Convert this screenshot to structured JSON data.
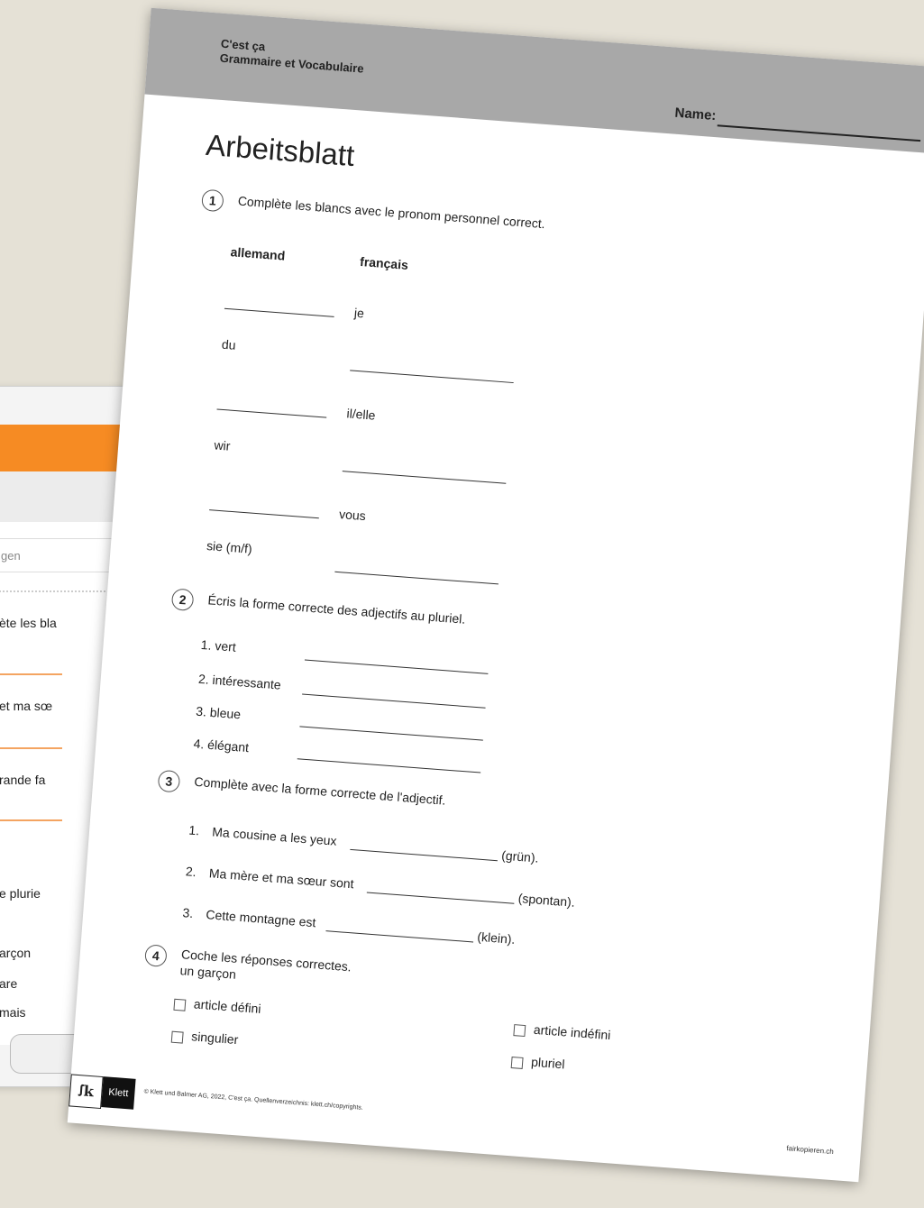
{
  "background_app": {
    "search_text": "gen",
    "row1": "ète les bla",
    "row2": "et ma sœ",
    "row3": "rande fa",
    "row4": "e plurie",
    "row5": "arçon",
    "row6": "are",
    "row7": "mais",
    "accent_color": "#f68b23"
  },
  "sheet": {
    "brand_line1": "C'est ça",
    "brand_line2": "Grammaire et Vocabulaire",
    "name_label": "Name:",
    "title": "Arbeitsblatt",
    "ex1": {
      "number": "1",
      "instruction": "Complète les blancs avec le pronom personnel correct.",
      "col_left": "allemand",
      "col_right": "français",
      "rows": [
        "je",
        "du",
        "il/elle",
        "wir",
        "vous",
        "sie (m/f)"
      ]
    },
    "ex2": {
      "number": "2",
      "instruction": "Écris la forme correcte des adjectifs au pluriel.",
      "items": [
        "1. vert",
        "2. intéressante",
        "3. bleue",
        "4. élégant"
      ]
    },
    "ex3": {
      "number": "3",
      "instruction": "Complète avec la forme correcte de l'adjectif.",
      "items": [
        {
          "num": "1.",
          "text": "Ma cousine a les yeux",
          "hint": "(grün)."
        },
        {
          "num": "2.",
          "text": "Ma mère et ma sœur sont",
          "hint": "(spontan)."
        },
        {
          "num": "3.",
          "text": "Cette montagne est",
          "hint": "(klein)."
        }
      ]
    },
    "ex4": {
      "number": "4",
      "instruction": "Coche les réponses correctes.",
      "word": "un garçon",
      "options": [
        "article défini",
        "article indéfini",
        "singulier",
        "pluriel"
      ]
    },
    "logo_symbol": "ꭍk",
    "logo_text": "Klett",
    "footer": "© Klett und Balmer AG, 2022, C'est ça. Quellenverzeichnis: klett.ch/copyrights.",
    "footer_right": "fairkopieren.ch"
  }
}
